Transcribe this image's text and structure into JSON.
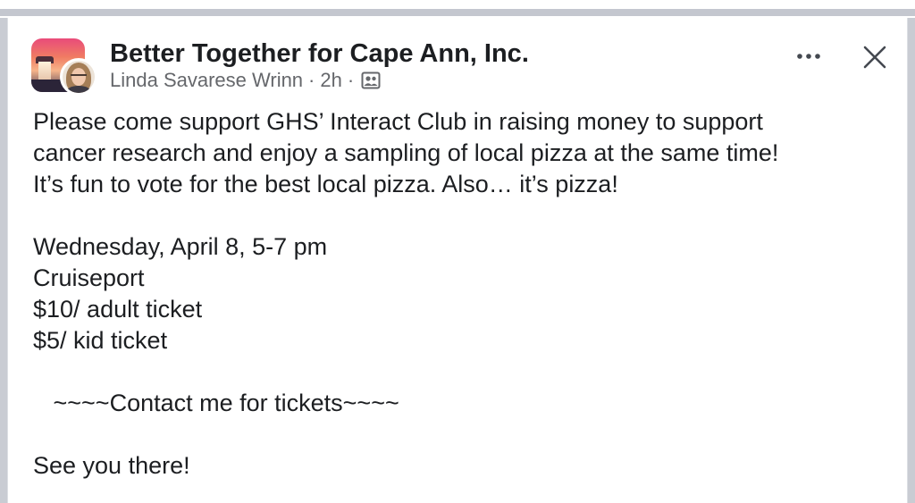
{
  "post": {
    "group_name": "Better Together for Cape Ann, Inc.",
    "author": "Linda Savarese Wrinn",
    "time": "2h",
    "separator": "·",
    "audience_icon": "group-members-icon",
    "more_icon": "more-options-icon",
    "close_icon": "close-icon",
    "body": {
      "intro_line_1": "Please come support GHS’ Interact Club in raising money to support",
      "intro_line_2": "cancer research and enjoy a sampling of local pizza at the same time!",
      "intro_line_3": "It’s fun to vote for the best local pizza. Also… it’s pizza!",
      "date_time": "Wednesday, April 8, 5-7 pm",
      "location": "Cruiseport",
      "adult_price": "$10/ adult ticket",
      "kid_price": "$5/ kid ticket",
      "contact": "   ~~~~Contact me for tickets~~~~",
      "closing": "See you there!"
    }
  },
  "colors": {
    "text_primary": "#1c1e21",
    "text_secondary": "#65676b",
    "background": "#ffffff"
  }
}
